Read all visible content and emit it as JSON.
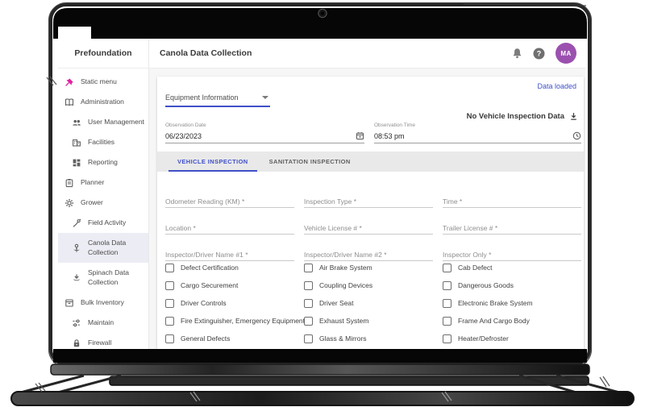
{
  "window": {
    "brand": "Prefoundation",
    "page_title": "Canola Data Collection",
    "avatar_initials": "MA",
    "help_glyph": "?"
  },
  "sidebar": {
    "items": [
      {
        "label": "Static menu",
        "icon": "pin-icon",
        "level": 0,
        "selected": false
      },
      {
        "label": "Administration",
        "icon": "book-icon",
        "level": 0,
        "selected": false
      },
      {
        "label": "User Management",
        "icon": "people-icon",
        "level": 1,
        "selected": false
      },
      {
        "label": "Facilities",
        "icon": "building-icon",
        "level": 1,
        "selected": false
      },
      {
        "label": "Reporting",
        "icon": "dashboard-icon",
        "level": 1,
        "selected": false
      },
      {
        "label": "Planner",
        "icon": "clipboard-icon",
        "level": 0,
        "selected": false
      },
      {
        "label": "Grower",
        "icon": "gear-icon",
        "level": 0,
        "selected": false
      },
      {
        "label": "Field Activity",
        "icon": "activity-icon",
        "level": 1,
        "selected": false
      },
      {
        "label": "Canola Data Collection",
        "icon": "flower-icon",
        "level": 1,
        "selected": true
      },
      {
        "label": "Spinach Data Collection",
        "icon": "sprout-icon",
        "level": 1,
        "selected": false
      },
      {
        "label": "Bulk Inventory",
        "icon": "inventory-icon",
        "level": 0,
        "selected": false
      },
      {
        "label": "Maintain",
        "icon": "tune-icon",
        "level": 1,
        "selected": false
      },
      {
        "label": "Firewall",
        "icon": "lock-icon",
        "level": 1,
        "selected": false
      }
    ]
  },
  "toolbar": {
    "status_text": "Data loaded",
    "section_select_value": "Equipment Information",
    "no_data_text": "No Vehicle Inspection Data",
    "observation_date": {
      "label": "Observation Date",
      "value": "06/23/2023"
    },
    "observation_time": {
      "label": "Observation Time",
      "value": "08:53 pm"
    }
  },
  "tabs": [
    {
      "label": "VEHICLE INSPECTION",
      "active": true
    },
    {
      "label": "SANITATION INSPECTION",
      "active": false
    }
  ],
  "form": {
    "placeholders": [
      "Odometer Reading (KM) *",
      "Inspection Type *",
      "Time *",
      "Location *",
      "Vehicle License # *",
      "Trailer License # *",
      "Inspector/Driver Name #1 *",
      "Inspector/Driver Name #2 *",
      "Inspector Only *"
    ],
    "checklist": [
      "Defect Certification",
      "Cargo Securement",
      "Driver Controls",
      "Fire Extinguisher, Emergency Equipment",
      "General Defects",
      "Air Brake System",
      "Coupling Devices",
      "Driver Seat",
      "Exhaust System",
      "Glass & Mirrors",
      "Cab Defect",
      "Dangerous Goods",
      "Electronic Brake System",
      "Frame And Cargo Body",
      "Heater/Defroster"
    ],
    "all_checkboxes_unchecked": true
  },
  "colors": {
    "accent": "#4050c8",
    "avatar": "#9b50af",
    "pin_icon": "#e0219e",
    "tabs_bar_bg": "#e9e9e9",
    "selected_item_bg": "#ececf4"
  }
}
